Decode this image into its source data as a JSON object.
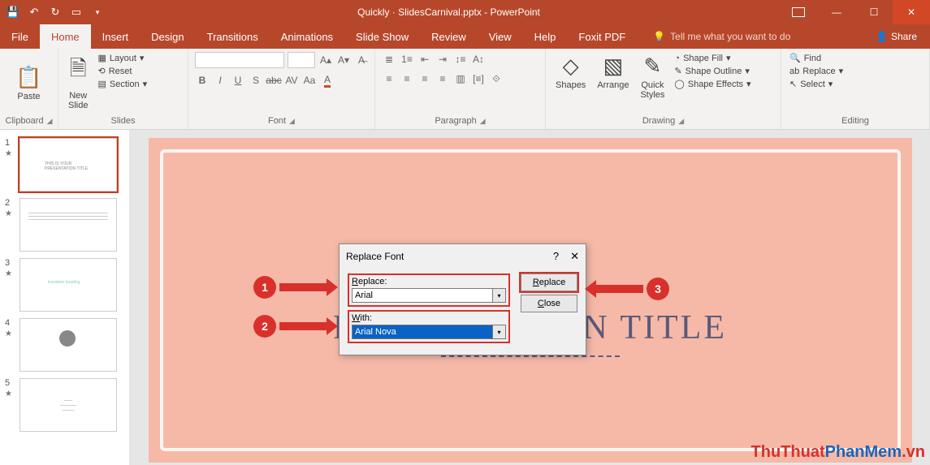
{
  "titlebar": {
    "document_title": "Quickly · SlidesCarnival.pptx  -  PowerPoint"
  },
  "tabs": {
    "file": "File",
    "home": "Home",
    "insert": "Insert",
    "design": "Design",
    "transitions": "Transitions",
    "animations": "Animations",
    "slideshow": "Slide Show",
    "review": "Review",
    "view": "View",
    "help": "Help",
    "foxit": "Foxit PDF",
    "tellme": "Tell me what you want to do",
    "share": "Share"
  },
  "ribbon": {
    "clipboard": {
      "label": "Clipboard",
      "paste": "Paste"
    },
    "slides": {
      "label": "Slides",
      "new_slide": "New\nSlide",
      "layout": "Layout",
      "reset": "Reset",
      "section": "Section"
    },
    "font": {
      "label": "Font"
    },
    "paragraph": {
      "label": "Paragraph"
    },
    "drawing": {
      "label": "Drawing",
      "shapes": "Shapes",
      "arrange": "Arrange",
      "quick_styles": "Quick\nStyles",
      "fill": "Shape Fill",
      "outline": "Shape Outline",
      "effects": "Shape Effects"
    },
    "editing": {
      "label": "Editing",
      "find": "Find",
      "replace": "Replace",
      "select": "Select"
    }
  },
  "thumbs": [
    "1",
    "2",
    "3",
    "4",
    "5"
  ],
  "slide": {
    "title_text": "PRESENTATION TITLE"
  },
  "dialog": {
    "title": "Replace Font",
    "replace_label": "Replace:",
    "replace_value": "Arial",
    "with_label": "With:",
    "with_value": "Arial Nova",
    "btn_replace": "Replace",
    "btn_close": "Close",
    "help": "?",
    "x": "✕"
  },
  "annotations": {
    "n1": "1",
    "n2": "2",
    "n3": "3"
  },
  "watermark": {
    "a": "ThuThuat",
    "b": "PhanMem",
    "c": ".vn"
  }
}
